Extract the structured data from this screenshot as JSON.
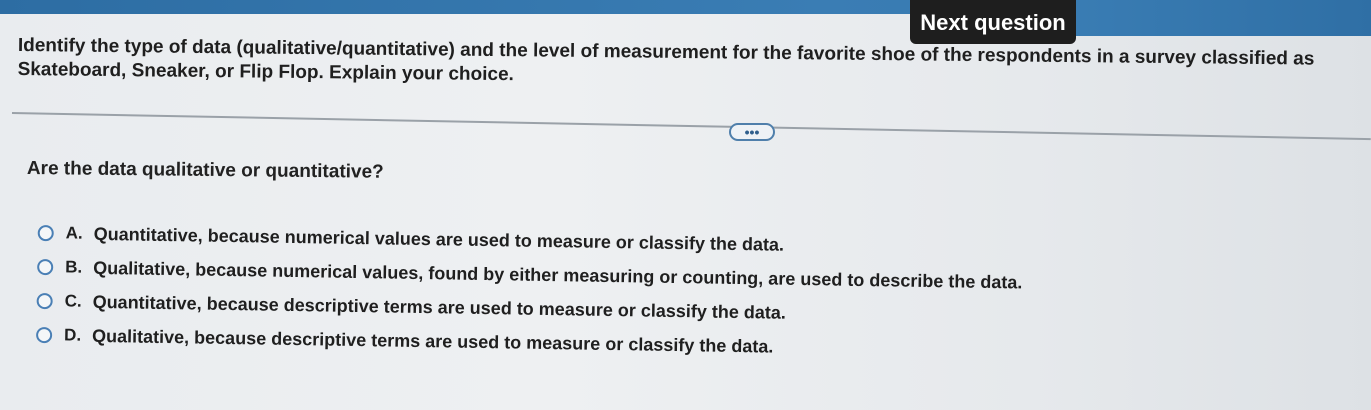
{
  "header": {
    "next_label": "Next question"
  },
  "problem": {
    "prompt": "Identify the type of data (qualitative/quantitative) and the level of measurement for the favorite shoe of the respondents in a survey classified as Skateboard, Sneaker, or Flip Flop. Explain your choice."
  },
  "toolbar": {
    "more_label": "•••"
  },
  "question": {
    "text": "Are the data qualitative or quantitative?",
    "options": [
      {
        "letter": "A.",
        "text": "Quantitative, because numerical values are used to measure or classify the data."
      },
      {
        "letter": "B.",
        "text": "Qualitative, because numerical values, found by either measuring or counting, are used to describe the data."
      },
      {
        "letter": "C.",
        "text": "Quantitative, because descriptive terms are used to measure or classify the data."
      },
      {
        "letter": "D.",
        "text": "Qualitative, because descriptive terms are used to measure or classify the data."
      }
    ]
  },
  "colors": {
    "header_blue": "#3a7db4",
    "radio_blue": "#4a7fb5",
    "button_dark": "#1e1e1e"
  }
}
